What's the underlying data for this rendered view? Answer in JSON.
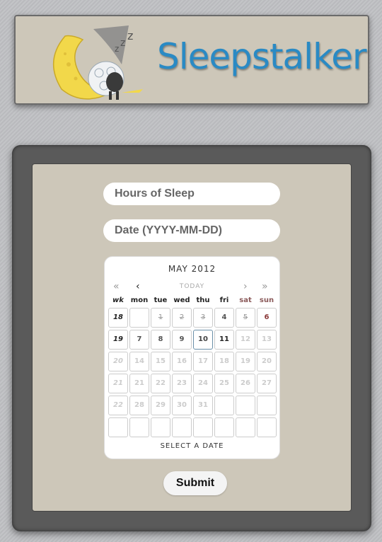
{
  "header": {
    "brand": "Sleepstalker"
  },
  "form": {
    "hours_placeholder": "Hours of Sleep",
    "date_placeholder": "Date (YYYY-MM-DD)",
    "submit_label": "Submit"
  },
  "calendar": {
    "month": "MAY 2012",
    "nav": {
      "prev_year": "«",
      "prev_month": "‹",
      "today": "TODAY",
      "next_month": "›",
      "next_year": "»"
    },
    "days": [
      "wk",
      "mon",
      "tue",
      "wed",
      "thu",
      "fri",
      "sat",
      "sun"
    ],
    "weeks": [
      [
        "18",
        "",
        "1",
        "2",
        "3",
        "4",
        "5",
        "6"
      ],
      [
        "19",
        "7",
        "8",
        "9",
        "10",
        "11",
        "12",
        "13"
      ],
      [
        "20",
        "14",
        "15",
        "16",
        "17",
        "18",
        "19",
        "20"
      ],
      [
        "21",
        "21",
        "22",
        "23",
        "24",
        "25",
        "26",
        "27"
      ],
      [
        "22",
        "28",
        "29",
        "30",
        "31",
        "",
        "",
        ""
      ],
      [
        "",
        "",
        "",
        "",
        "",
        "",
        "",
        ""
      ]
    ],
    "footer": "SELECT A DATE"
  }
}
